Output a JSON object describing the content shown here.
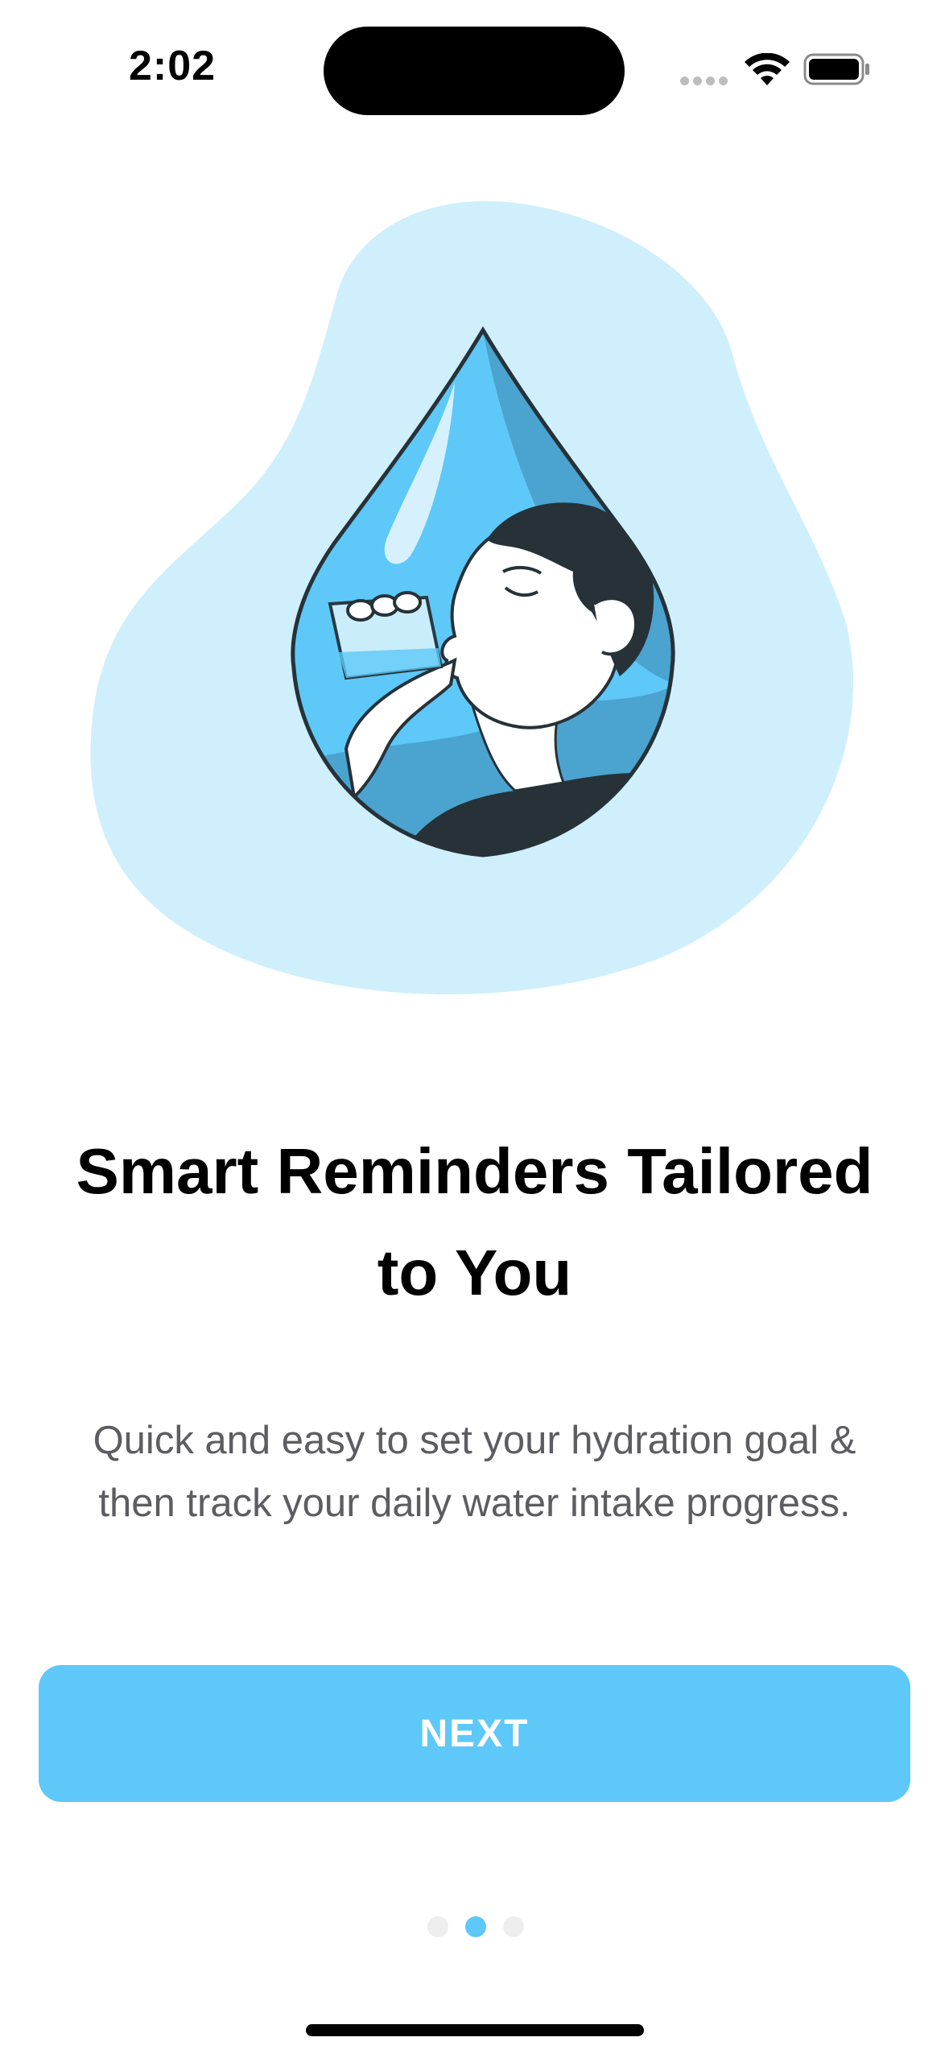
{
  "status_bar": {
    "time": "2:02",
    "icons": [
      "cellular-signal-icon",
      "wifi-icon",
      "battery-icon"
    ]
  },
  "illustration": {
    "name": "person-drinking-water-in-drop-illustration",
    "colors": {
      "blob": "#cfeffc",
      "drop_light": "#5ec8f8",
      "drop_dark": "#4ba3d0",
      "outline": "#263238",
      "hair": "#263238"
    }
  },
  "onboarding": {
    "title": "Smart Reminders Tailored to You",
    "description": "Quick and easy to set your hydration goal & then track your daily water intake progress.",
    "next_label": "NEXT",
    "page_indicator": {
      "total": 3,
      "current": 2
    }
  },
  "colors": {
    "accent": "#5ec8f8",
    "title_text": "#000000",
    "body_text": "#5c5c61",
    "inactive_dot": "#eeeeef"
  }
}
